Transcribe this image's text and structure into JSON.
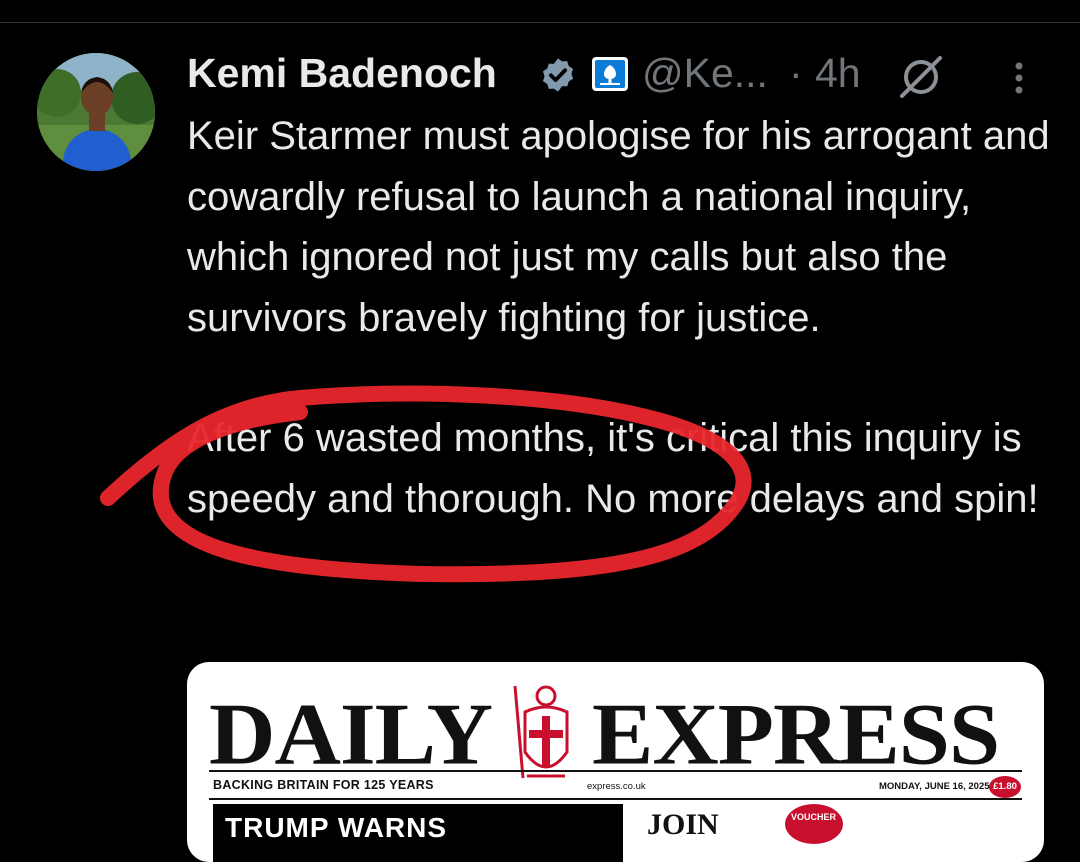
{
  "tweet": {
    "author_name": "Kemi Badenoch",
    "handle": "@Ke...",
    "dot": "·",
    "time": "4h",
    "paragraphs": [
      "Keir Starmer must apologise for his arrogant and cowardly refusal to launch a national inquiry, which ignored not just my calls but also the survivors bravely fighting for justice.",
      "After 6 wasted months, it's critical this inquiry is speedy and thorough. No more delays and spin!"
    ],
    "icons": [
      "verified-badge-icon",
      "government-affiliation-icon",
      "grok-icon",
      "more-options-icon"
    ]
  },
  "newspaper_card": {
    "masthead_left": "DAILY",
    "masthead_right": "EXPRESS",
    "tagline": "BACKING BRITAIN FOR 125 YEARS",
    "url": "express.co.uk",
    "date": "MONDAY, JUNE 16, 2025",
    "price": "£1.80",
    "left_headline": "TRUMP WARNS",
    "right_headline": "JOIN",
    "voucher": "VOUCHER"
  },
  "colors": {
    "background": "#000000",
    "text": "#e7e9ea",
    "muted": "#71767b",
    "verified": "#829aab",
    "annotation": "#e8262c"
  }
}
